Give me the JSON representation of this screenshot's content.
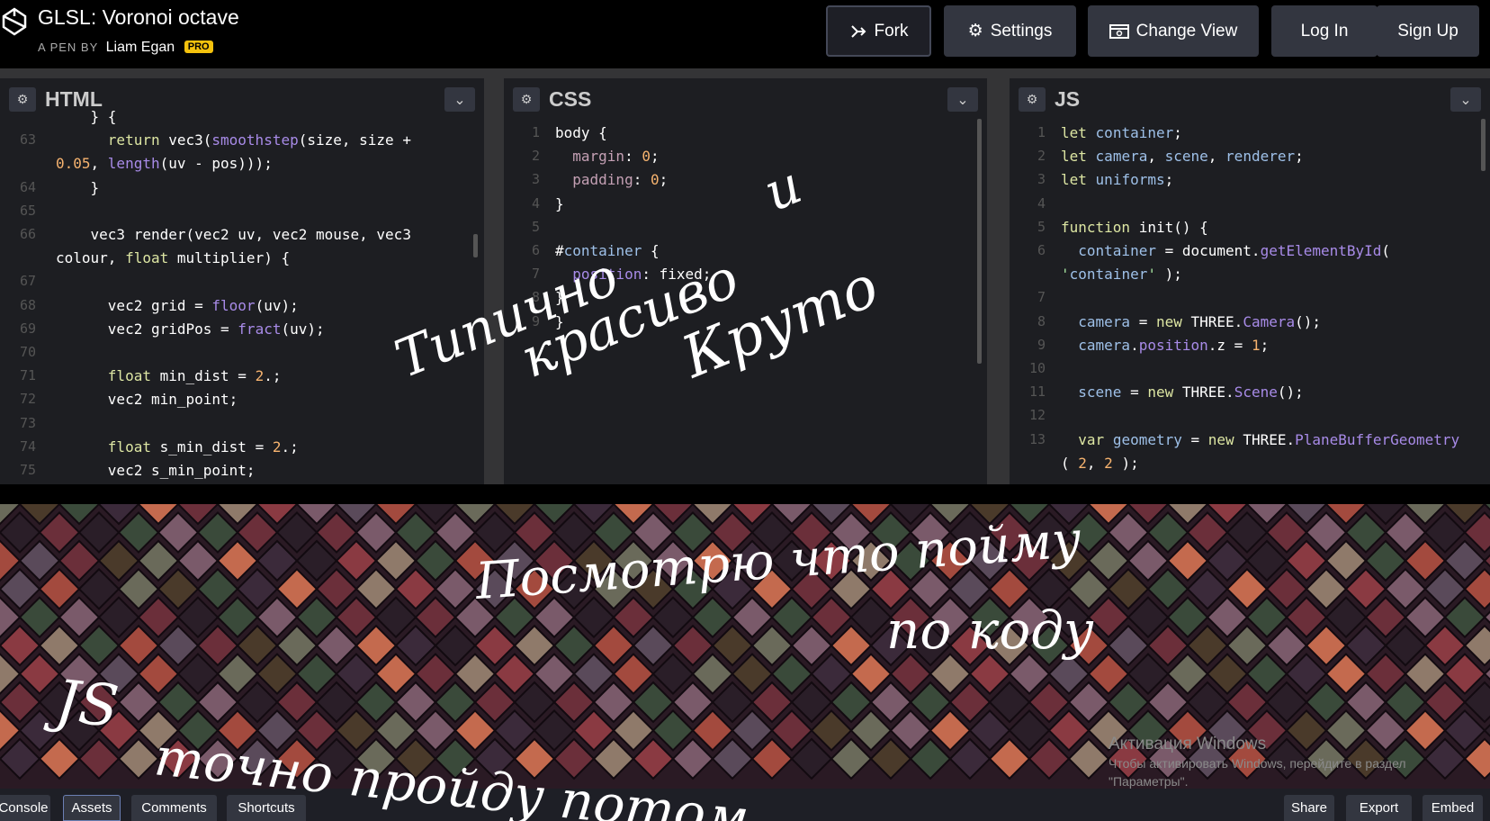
{
  "header": {
    "title": "GLSL: Voronoi octave",
    "byline_prefix": "A PEN BY",
    "author": "Liam Egan",
    "badge": "PRO",
    "buttons": {
      "fork": "Fork",
      "settings": "Settings",
      "change_view": "Change View",
      "login": "Log In",
      "signup": "Sign Up"
    }
  },
  "editors": {
    "html": {
      "title": "HTML",
      "lines": [
        {
          "n": "",
          "t": "    } {"
        },
        {
          "n": "63",
          "t": "      return vec3(smoothstep(size, size +"
        },
        {
          "n": "",
          "t": "0.05, length(uv - pos)));"
        },
        {
          "n": "64",
          "t": "    }"
        },
        {
          "n": "65",
          "t": ""
        },
        {
          "n": "66",
          "t": "    vec3 render(vec2 uv, vec2 mouse, vec3"
        },
        {
          "n": "",
          "t": "colour, float multiplier) {"
        },
        {
          "n": "67",
          "t": ""
        },
        {
          "n": "68",
          "t": "      vec2 grid = floor(uv);"
        },
        {
          "n": "69",
          "t": "      vec2 gridPos = fract(uv);"
        },
        {
          "n": "70",
          "t": ""
        },
        {
          "n": "71",
          "t": "      float min_dist = 2.;"
        },
        {
          "n": "72",
          "t": "      vec2 min_point;"
        },
        {
          "n": "73",
          "t": ""
        },
        {
          "n": "74",
          "t": "      float s_min_dist = 2.;"
        },
        {
          "n": "75",
          "t": "      vec2 s_min_point;"
        }
      ]
    },
    "css": {
      "title": "CSS",
      "lines": [
        {
          "n": "1",
          "t": "body {"
        },
        {
          "n": "2",
          "t": "  margin: 0;"
        },
        {
          "n": "3",
          "t": "  padding: 0;"
        },
        {
          "n": "4",
          "t": "}"
        },
        {
          "n": "5",
          "t": ""
        },
        {
          "n": "6",
          "t": "#container {"
        },
        {
          "n": "7",
          "t": "  position: fixed;"
        },
        {
          "n": "8",
          "t": "}"
        },
        {
          "n": "9",
          "t": "}"
        }
      ]
    },
    "js": {
      "title": "JS",
      "lines": [
        {
          "n": "1",
          "t": "let container;"
        },
        {
          "n": "2",
          "t": "let camera, scene, renderer;"
        },
        {
          "n": "3",
          "t": "let uniforms;"
        },
        {
          "n": "4",
          "t": ""
        },
        {
          "n": "5",
          "t": "function init() {"
        },
        {
          "n": "6",
          "t": "  container = document.getElementById("
        },
        {
          "n": "",
          "t": "'container' );"
        },
        {
          "n": "7",
          "t": ""
        },
        {
          "n": "8",
          "t": "  camera = new THREE.Camera();"
        },
        {
          "n": "9",
          "t": "  camera.position.z = 1;"
        },
        {
          "n": "10",
          "t": ""
        },
        {
          "n": "11",
          "t": "  scene = new THREE.Scene();"
        },
        {
          "n": "12",
          "t": ""
        },
        {
          "n": "13",
          "t": "  var geometry = new THREE.PlaneBufferGeometry"
        },
        {
          "n": "",
          "t": "( 2, 2 );"
        }
      ]
    }
  },
  "handwriting": {
    "note1_line1": "Типично",
    "note1_line2": "и",
    "note2": "красиво",
    "note3": "Круто",
    "note4_line1": "Посмотрю что пойму",
    "note4_line2": "по коду",
    "note5_line1": "JS",
    "note5_line2": "точно пройду потом."
  },
  "watermark": {
    "title": "Активация Windows",
    "line1": "Чтобы активировать Windows, перейдите в раздел",
    "line2": "\"Параметры\"."
  },
  "footer": {
    "console": "Console",
    "assets": "Assets",
    "comments": "Comments",
    "shortcuts": "Shortcuts",
    "share": "Share",
    "export": "Export",
    "embed": "Embed"
  },
  "colors": {
    "accent_badge": "#f4c20d",
    "editor_bg": "#1d1e22",
    "button_bg": "#333640"
  }
}
